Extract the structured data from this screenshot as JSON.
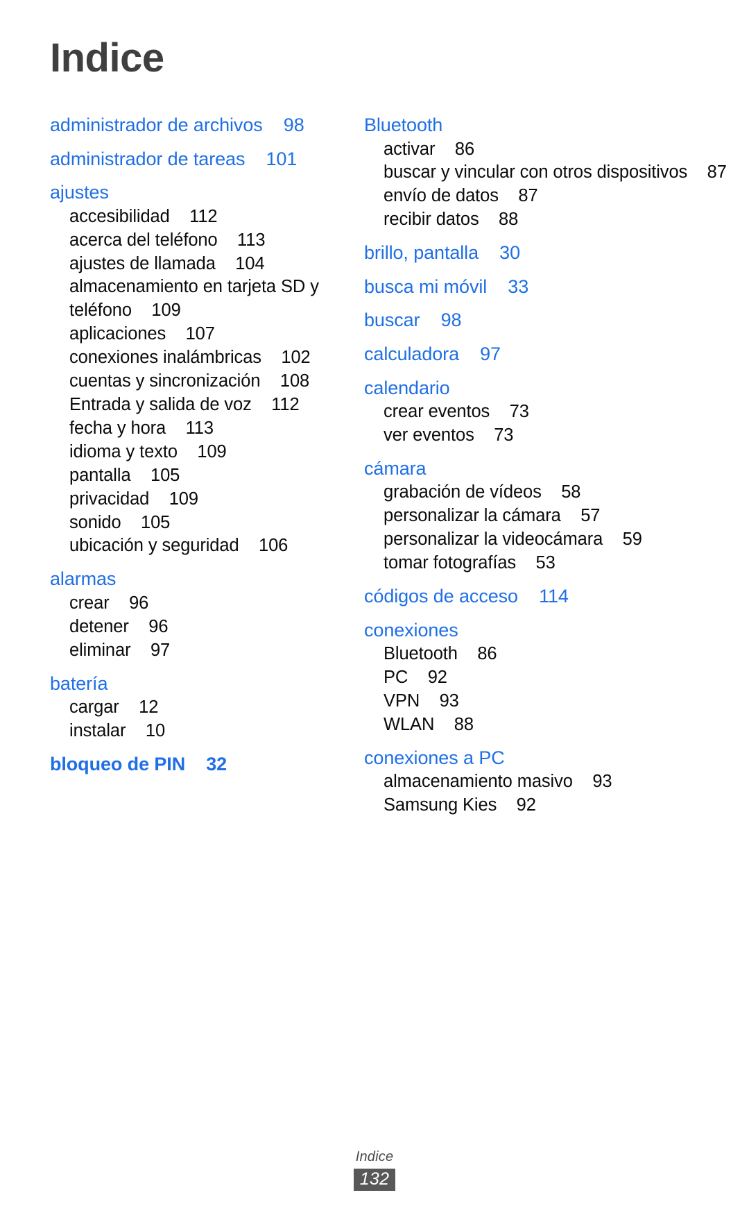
{
  "document": {
    "title": "Indice",
    "title_color": "#3f3f3f",
    "heading_color": "#1f6fe5",
    "sub_color": "#0b0b0b"
  },
  "footer": {
    "label": "Indice",
    "page_number": "132",
    "page_box_color": "#585858"
  },
  "index": {
    "left_column": [
      {
        "label": "administrador de archivos",
        "page": "98",
        "level": "head",
        "bold": false
      },
      {
        "label": "administrador de tareas",
        "page": "101",
        "level": "head",
        "bold": false
      },
      {
        "label": "ajustes",
        "page": "",
        "level": "head",
        "bold": false
      },
      {
        "label": "accesibilidad",
        "page": "112",
        "level": "sub"
      },
      {
        "label": "acerca del teléfono",
        "page": "113",
        "level": "sub"
      },
      {
        "label": "ajustes de llamada",
        "page": "104",
        "level": "sub"
      },
      {
        "label": "almacenamiento en tarjeta SD y teléfono",
        "page": "109",
        "level": "sub"
      },
      {
        "label": "aplicaciones",
        "page": "107",
        "level": "sub"
      },
      {
        "label": "conexiones inalámbricas",
        "page": "102",
        "level": "sub"
      },
      {
        "label": "cuentas y sincronización",
        "page": "108",
        "level": "sub"
      },
      {
        "label": "Entrada y salida de voz",
        "page": "112",
        "level": "sub"
      },
      {
        "label": "fecha y hora",
        "page": "113",
        "level": "sub"
      },
      {
        "label": "idioma y texto",
        "page": "109",
        "level": "sub"
      },
      {
        "label": "pantalla",
        "page": "105",
        "level": "sub"
      },
      {
        "label": "privacidad",
        "page": "109",
        "level": "sub"
      },
      {
        "label": "sonido",
        "page": "105",
        "level": "sub"
      },
      {
        "label": "ubicación y seguridad",
        "page": "106",
        "level": "sub"
      },
      {
        "label": "alarmas",
        "page": "",
        "level": "head",
        "bold": false
      },
      {
        "label": "crear",
        "page": "96",
        "level": "sub"
      },
      {
        "label": "detener",
        "page": "96",
        "level": "sub"
      },
      {
        "label": "eliminar",
        "page": "97",
        "level": "sub"
      },
      {
        "label": "batería",
        "page": "",
        "level": "head",
        "bold": false
      },
      {
        "label": "cargar",
        "page": "12",
        "level": "sub"
      },
      {
        "label": "instalar",
        "page": "10",
        "level": "sub"
      },
      {
        "label": "bloqueo de PIN",
        "page": "32",
        "level": "head",
        "bold": true
      }
    ],
    "right_column": [
      {
        "label": "Bluetooth",
        "page": "",
        "level": "head",
        "bold": false
      },
      {
        "label": "activar",
        "page": "86",
        "level": "sub"
      },
      {
        "label": "buscar y vincular con otros dispositivos",
        "page": "87",
        "level": "sub"
      },
      {
        "label": "envío de datos",
        "page": "87",
        "level": "sub"
      },
      {
        "label": "recibir datos",
        "page": "88",
        "level": "sub"
      },
      {
        "label": "brillo, pantalla",
        "page": "30",
        "level": "head",
        "bold": false
      },
      {
        "label": "busca mi móvil",
        "page": "33",
        "level": "head",
        "bold": false
      },
      {
        "label": "buscar",
        "page": "98",
        "level": "head",
        "bold": false
      },
      {
        "label": "calculadora",
        "page": "97",
        "level": "head",
        "bold": false
      },
      {
        "label": "calendario",
        "page": "",
        "level": "head",
        "bold": false
      },
      {
        "label": "crear eventos",
        "page": "73",
        "level": "sub"
      },
      {
        "label": "ver eventos",
        "page": "73",
        "level": "sub"
      },
      {
        "label": "cámara",
        "page": "",
        "level": "head",
        "bold": false
      },
      {
        "label": "grabación de vídeos",
        "page": "58",
        "level": "sub"
      },
      {
        "label": "personalizar la cámara",
        "page": "57",
        "level": "sub"
      },
      {
        "label": "personalizar la videocámara",
        "page": "59",
        "level": "sub"
      },
      {
        "label": "tomar fotografías",
        "page": "53",
        "level": "sub"
      },
      {
        "label": "códigos de acceso",
        "page": "114",
        "level": "head",
        "bold": false
      },
      {
        "label": "conexiones",
        "page": "",
        "level": "head",
        "bold": false
      },
      {
        "label": "Bluetooth",
        "page": "86",
        "level": "sub"
      },
      {
        "label": "PC",
        "page": "92",
        "level": "sub"
      },
      {
        "label": "VPN",
        "page": "93",
        "level": "sub"
      },
      {
        "label": "WLAN",
        "page": "88",
        "level": "sub"
      },
      {
        "label": "conexiones a PC",
        "page": "",
        "level": "head",
        "bold": false
      },
      {
        "label": "almacenamiento masivo",
        "page": "93",
        "level": "sub"
      },
      {
        "label": "Samsung Kies",
        "page": "92",
        "level": "sub"
      }
    ]
  }
}
